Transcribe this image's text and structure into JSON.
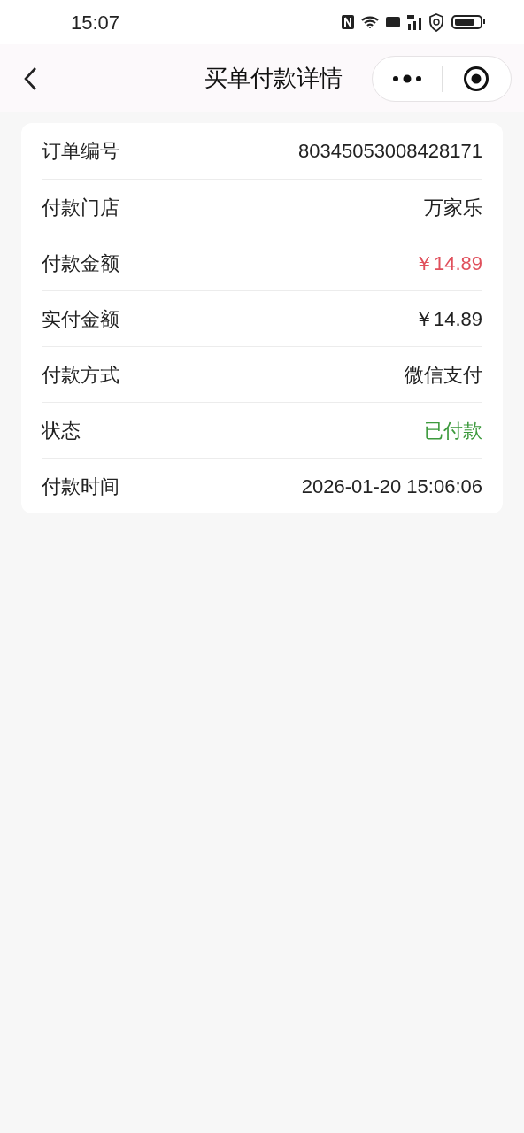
{
  "status_bar": {
    "time": "15:07"
  },
  "header": {
    "title": "买单付款详情"
  },
  "rows": [
    {
      "label": "订单编号",
      "value": "80345053008428171",
      "kind": "plain"
    },
    {
      "label": "付款门店",
      "value": "万家乐",
      "kind": "plain"
    },
    {
      "label": "付款金额",
      "value": "￥14.89",
      "kind": "price"
    },
    {
      "label": "实付金额",
      "value": "￥14.89",
      "kind": "plain"
    },
    {
      "label": "付款方式",
      "value": "微信支付",
      "kind": "plain"
    },
    {
      "label": "状态",
      "value": "已付款",
      "kind": "status"
    },
    {
      "label": "付款时间",
      "value": "2026-01-20 15:06:06",
      "kind": "plain"
    }
  ]
}
